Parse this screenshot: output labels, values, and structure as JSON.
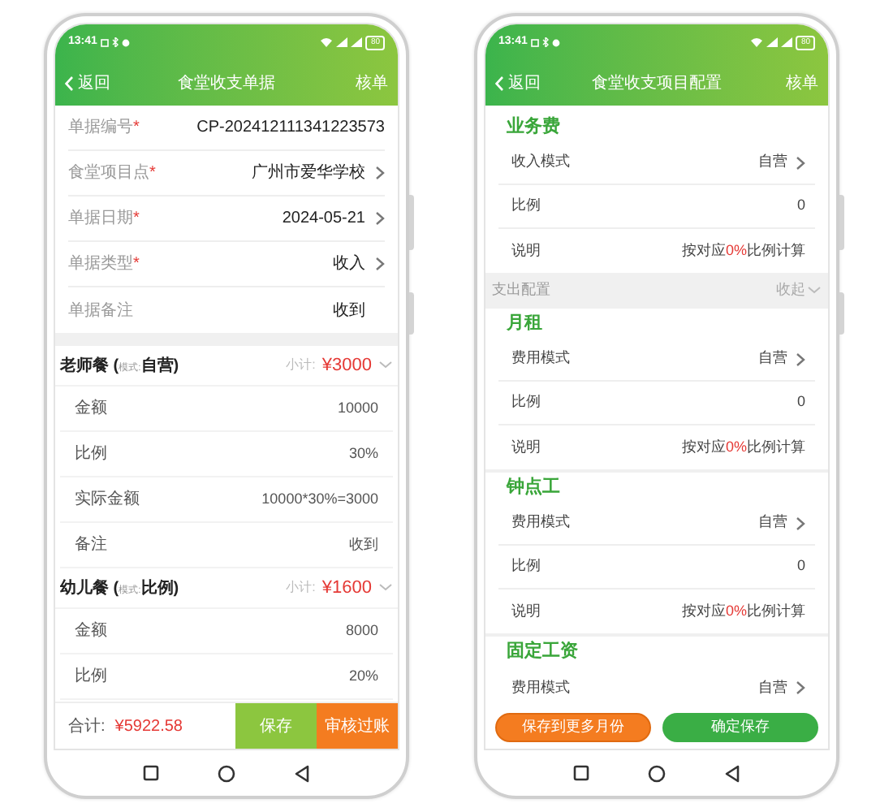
{
  "bill_screen": {
    "status_bar": {
      "time": "13:41",
      "battery": "80"
    },
    "header": {
      "back": "返回",
      "title": "食堂收支单据",
      "action": "核单"
    },
    "fields": [
      {
        "label": "单据编号",
        "required_mark": "*",
        "value": "CP-202412111341223573",
        "has_arrow": false
      },
      {
        "label": "食堂项目点",
        "required_mark": "*",
        "value": "广州市爱华学校",
        "has_arrow": true
      },
      {
        "label": "单据日期",
        "required_mark": "*",
        "value": "2024-05-21",
        "has_arrow": true
      },
      {
        "label": "单据类型",
        "required_mark": "*",
        "value": "收入",
        "has_arrow": true
      },
      {
        "label": "单据备注",
        "value": "收到",
        "has_arrow": false
      }
    ],
    "sections": [
      {
        "title": "老师餐 ($_{模式:}$自营)",
        "subtotal_label": "小计:",
        "subtotal": "¥3000",
        "expanded": true,
        "rows": [
          {
            "label": "金额",
            "value": "10000"
          },
          {
            "label": "比例",
            "value": "30%"
          },
          {
            "label": "实际金额",
            "value": "10000*30%=3000"
          },
          {
            "label": "备注",
            "value": "收到"
          }
        ]
      },
      {
        "title": "幼儿餐 ($_{模式:}$比例)",
        "subtotal_label": "小计:",
        "subtotal": "¥1600",
        "expanded": true,
        "rows": [
          {
            "label": "金额",
            "value": "8000"
          },
          {
            "label": "比例",
            "value": "20%"
          }
        ]
      }
    ],
    "footer": {
      "total_label": "合计:",
      "total": "¥5922.58",
      "buttons": [
        {
          "label": "保存",
          "kind": "save"
        },
        {
          "label": "审核过账",
          "kind": "post"
        }
      ]
    }
  },
  "config_screen": {
    "status_bar": {
      "time": "13:41",
      "battery": "80"
    },
    "header": {
      "back": "返回",
      "title": "食堂收支项目配置",
      "action": "核单"
    },
    "sections": [
      {
        "kind": "group",
        "title": "业务费",
        "rows": [
          {
            "label": "收入模式",
            "value": "自营",
            "has_arrow": true
          },
          {
            "label": "比例",
            "value": "0",
            "has_arrow": false
          },
          {
            "label": "说明",
            "value": "按对应**0%**比例计算",
            "has_arrow": false
          }
        ]
      },
      {
        "kind": "band",
        "label": "支出配置",
        "action": "收起"
      },
      {
        "kind": "group",
        "title": "月租",
        "rows": [
          {
            "label": "费用模式",
            "value": "自营",
            "has_arrow": true
          },
          {
            "label": "比例",
            "value": "0",
            "has_arrow": false
          },
          {
            "label": "说明",
            "value": "按对应**0%**比例计算",
            "has_arrow": false
          }
        ]
      },
      {
        "kind": "group",
        "title": "钟点工",
        "rows": [
          {
            "label": "费用模式",
            "value": "自营",
            "has_arrow": true
          },
          {
            "label": "比例",
            "value": "0",
            "has_arrow": false
          },
          {
            "label": "说明",
            "value": "按对应**0%**比例计算",
            "has_arrow": false
          }
        ]
      },
      {
        "kind": "group",
        "title": "固定工资",
        "rows": [
          {
            "label": "费用模式",
            "value": "自营",
            "has_arrow": true
          }
        ]
      }
    ],
    "footer": {
      "buttons": [
        {
          "label": "保存到更多月份",
          "kind": "secondary"
        },
        {
          "label": "确定保存",
          "kind": "primary"
        }
      ]
    }
  }
}
